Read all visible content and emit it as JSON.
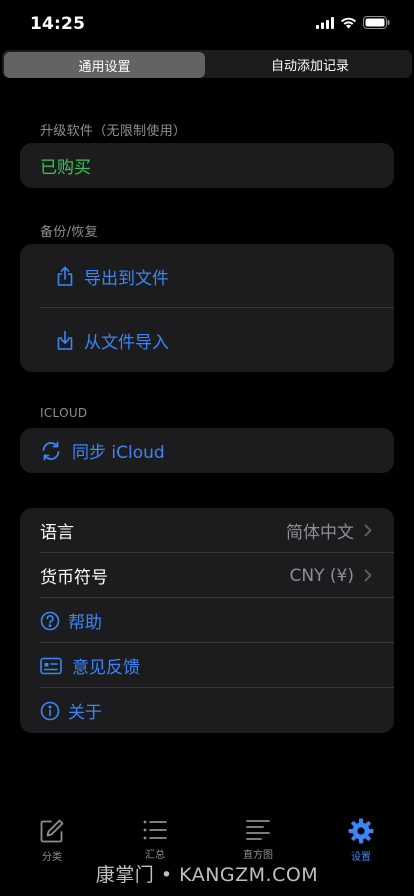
{
  "status_bar": {
    "time": "14:25"
  },
  "segments": {
    "active": "通用设置",
    "inactive": "自动添加记录"
  },
  "upgrade": {
    "header": "升级软件（无限制使用）",
    "status": "已购买"
  },
  "backup": {
    "header": "备份/恢复",
    "export_label": "导出到文件",
    "import_label": "从文件导入"
  },
  "icloud": {
    "header": "ICLOUD",
    "sync_label": "同步 iCloud"
  },
  "settings": {
    "language_label": "语言",
    "language_value": "简体中文",
    "currency_label": "货币符号",
    "currency_value": "CNY (¥)",
    "help_label": "帮助",
    "feedback_label": "意见反馈",
    "about_label": "关于"
  },
  "tabs": [
    {
      "label": "分类",
      "icon": "edit-icon"
    },
    {
      "label": "汇总",
      "icon": "list-icon"
    },
    {
      "label": "直方图",
      "icon": "text-align-icon"
    },
    {
      "label": "设置",
      "icon": "gear-icon",
      "active": true
    }
  ],
  "watermark": "康掌门 • KANGZM.COM",
  "colors": {
    "accent": "#3a86f7",
    "success": "#34c759",
    "card": "#1c1c1e",
    "background": "#000000"
  }
}
